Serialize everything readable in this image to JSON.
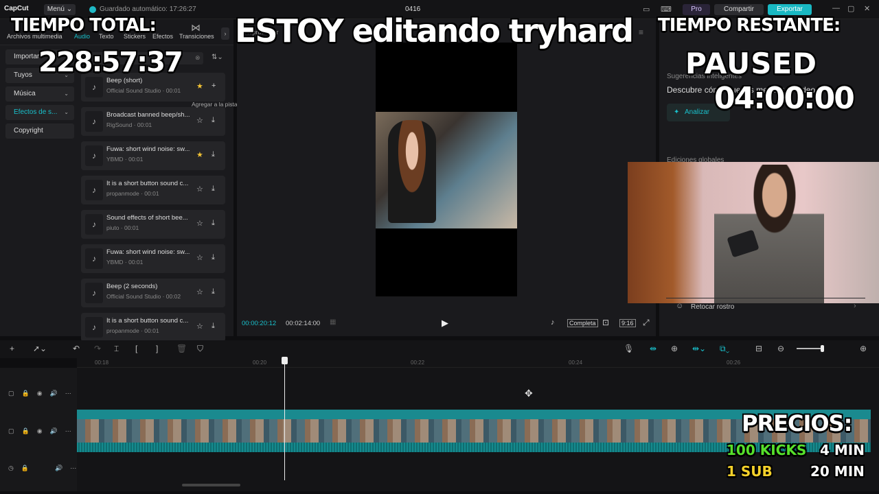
{
  "topbar": {
    "logo": "CapCut",
    "menu": "Menú ⌄",
    "autosave": "Guardado automático: 17:26:27",
    "project_name": "0416",
    "pro": "Pro",
    "share": "Compartir",
    "export": "Exportar",
    "window_controls": [
      "—",
      "▢",
      "✕"
    ]
  },
  "tabs": [
    "Archivos multimedia",
    "Audio",
    "Texto",
    "Stickers",
    "Efectos",
    "Transiciones"
  ],
  "sidebar": [
    {
      "label": "Importar",
      "chevron": ""
    },
    {
      "label": "Tuyos",
      "chevron": "⌄"
    },
    {
      "label": "Música",
      "chevron": "⌄"
    },
    {
      "label": "Efectos de s...",
      "chevron": "⌄"
    },
    {
      "label": "Copyright",
      "chevron": ""
    }
  ],
  "sounds": [
    {
      "title": "Beep (short)",
      "sub": "Official Sound Studio · 00:01",
      "star": "★",
      "star_on": true,
      "action": "+"
    },
    {
      "title": "Broadcast banned beep/sh...",
      "sub": "RigSound · 00:01",
      "star": "☆",
      "star_on": false,
      "action": "⤓"
    },
    {
      "title": "Fuwa: short wind noise: sw...",
      "sub": "YBMD · 00:01",
      "star": "★",
      "star_on": true,
      "action": "⤓"
    },
    {
      "title": "It is a short button sound c...",
      "sub": "propanmode · 00:01",
      "star": "☆",
      "star_on": false,
      "action": "⤓"
    },
    {
      "title": "Sound effects of short bee...",
      "sub": "piuto · 00:01",
      "star": "☆",
      "star_on": false,
      "action": "⤓"
    },
    {
      "title": "Fuwa: short wind noise: sw...",
      "sub": "YBMD · 00:01",
      "star": "☆",
      "star_on": false,
      "action": "⤓"
    },
    {
      "title": "Beep (2 seconds)",
      "sub": "Official Sound Studio · 00:02",
      "star": "☆",
      "star_on": false,
      "action": "⤓"
    },
    {
      "title": "It is a short button sound c...",
      "sub": "propanmode · 00:01",
      "star": "☆",
      "star_on": false,
      "action": "⤓"
    }
  ],
  "tooltip": "Agregar a la pista",
  "player": {
    "current_time": "00:00:20:12",
    "total_time": "00:02:14:00",
    "full": "Completa",
    "ratio": "9:16"
  },
  "right_panel": {
    "suggestions_label": "Sugerencias inteligentes",
    "suggestions_text": "Descubre cómo puedes mejorar tu video",
    "analyze": "Analizar",
    "global_label": "Ediciones globales",
    "retouch": "Retocar rostro"
  },
  "ruler_ticks": [
    "00:18",
    "00:20",
    "00:22",
    "00:24",
    "00:26"
  ],
  "overlay": {
    "total_label": "TIEMPO TOTAL:",
    "total_time": "228:57:37",
    "title": "ESTOY editando tryhard",
    "remaining_label": "TIEMPO RESTANTE:",
    "paused": "PAUSED",
    "countdown": "04:00:00",
    "prices_label": "PRECIOS:",
    "price1_key": "100 KICKS",
    "price1_val": "4 MIN",
    "price2_key": "1 SUB",
    "price2_val": "20 MIN"
  },
  "colors": {
    "accent": "#19c1cc",
    "kicks": "#56e02b",
    "sub": "#f4d12a"
  }
}
